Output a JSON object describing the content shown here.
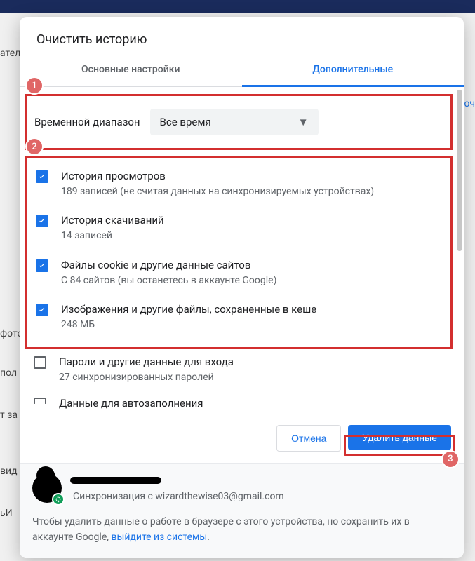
{
  "dialog": {
    "title": "Очистить историю",
    "tabs": {
      "basic": "Основные настройки",
      "advanced": "Дополнительные"
    },
    "time_range": {
      "label": "Временной диапазон",
      "value": "Все время"
    },
    "items": [
      {
        "title": "История просмотров",
        "sub": "189 записей (не считая данных на синхронизируемых устройствах)",
        "checked": true
      },
      {
        "title": "История скачиваний",
        "sub": "14 записей",
        "checked": true
      },
      {
        "title": "Файлы cookie и другие данные сайтов",
        "sub": "С 84 сайтов (вы останетесь в аккаунте Google)",
        "checked": true
      },
      {
        "title": "Изображения и другие файлы, сохраненные в кеше",
        "sub": "248 МБ",
        "checked": true
      },
      {
        "title": "Пароли и другие данные для входа",
        "sub": "27 синхронизированных паролей",
        "checked": false
      },
      {
        "title": "Данные для автозаполнения",
        "sub": "",
        "checked": false
      }
    ],
    "buttons": {
      "cancel": "Отмена",
      "delete": "Удалить данные"
    },
    "profile": {
      "name": "redacted",
      "sync_line": "Синхронизация с wizardthewise03@gmail.com"
    },
    "footer": {
      "text_pre": "Чтобы удалить данные о работе в браузере с этого устройства, но сохранить их в аккаунте Google, ",
      "link": "выйдите из системы",
      "text_post": "."
    },
    "annotations": {
      "b1": "1",
      "b2": "2",
      "b3": "3"
    }
  },
  "backdrop": {
    "left_labels": [
      "атель",
      "фото",
      "пол",
      "т за",
      "вид",
      "ьИ"
    ],
    "right_label": "ключ"
  }
}
